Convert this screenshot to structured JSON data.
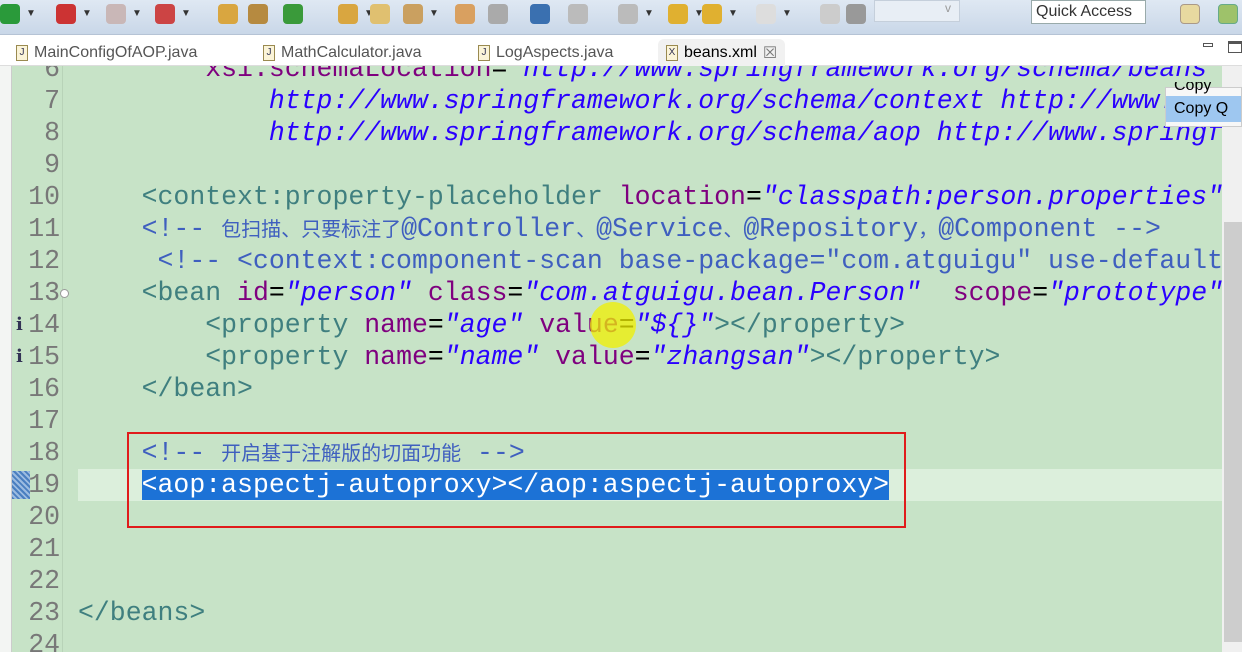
{
  "toolbar": {
    "quick_access": "Quick Access",
    "combo_arrow": "v",
    "icons": [
      "run-icon",
      "debug-icon",
      "stop-icon",
      "external-tools-icon",
      "new-icon",
      "package-icon",
      "refresh-icon",
      "open-folder-icon",
      "open-file-icon",
      "pen-icon",
      "bookmark-icon",
      "settings-icon",
      "globe-icon",
      "next-annotation-icon",
      "prev-annotation-icon",
      "back-icon",
      "back-history-icon",
      "forward-icon",
      "pin-icon",
      "grid-icon"
    ]
  },
  "tabs": [
    {
      "label": "MainConfigOfAOP.java",
      "icon": "J"
    },
    {
      "label": "MathCalculator.java",
      "icon": "J"
    },
    {
      "label": "LogAspects.java",
      "icon": "J"
    },
    {
      "label": "beans.xml",
      "icon": "X",
      "active": true,
      "close": "☒"
    }
  ],
  "popup": {
    "items": [
      "Copy",
      "Copy Q"
    ]
  },
  "colors": {
    "editor_bg": "#c7e3c7",
    "tag": "#3f7f7f",
    "attr": "#7f007f",
    "value": "#2a00ff",
    "comment": "#3f5fbf",
    "selection": "#1c72d6",
    "highlight_box": "#e01b1b"
  },
  "editor": {
    "lines": [
      {
        "n": "6",
        "indent": "        ",
        "parts": [
          [
            "a",
            "xsi:schemaLocation"
          ],
          [
            "k",
            "="
          ],
          [
            "v",
            "\"http://www.springframework.org/schema/beans http"
          ]
        ]
      },
      {
        "n": "7",
        "indent": "            ",
        "parts": [
          [
            "v",
            "http://www.springframework.org/schema/context http://www.spr"
          ]
        ]
      },
      {
        "n": "8",
        "indent": "            ",
        "parts": [
          [
            "v",
            "http://www.springframework.org/schema/aop http://www.springframe"
          ]
        ]
      },
      {
        "n": "9",
        "indent": "",
        "parts": []
      },
      {
        "n": "10",
        "indent": "    ",
        "parts": [
          [
            "t",
            "<context:property-placeholder "
          ],
          [
            "a",
            "location"
          ],
          [
            "k",
            "="
          ],
          [
            "v",
            "\"classpath:person.properties\""
          ]
        ]
      },
      {
        "n": "11",
        "indent": "    ",
        "parts": [
          [
            "c",
            "<!-- "
          ],
          [
            "ccn",
            "包扫描、只要标注了"
          ],
          [
            "c",
            "@Controller"
          ],
          [
            "ccn",
            "、"
          ],
          [
            "c",
            "@Service"
          ],
          [
            "ccn",
            "、"
          ],
          [
            "c",
            "@Repository"
          ],
          [
            "ccn",
            "，"
          ],
          [
            "c",
            "@Component -->"
          ]
        ]
      },
      {
        "n": "12",
        "indent": "     ",
        "parts": [
          [
            "c",
            "<!-- <context:component-scan base-package=\"com.atguigu\" use-default"
          ]
        ]
      },
      {
        "n": "13",
        "indent": "    ",
        "fold": true,
        "parts": [
          [
            "t",
            "<bean "
          ],
          [
            "a",
            "id"
          ],
          [
            "k",
            "="
          ],
          [
            "v",
            "\"person\""
          ],
          [
            "t",
            " "
          ],
          [
            "a",
            "class"
          ],
          [
            "k",
            "="
          ],
          [
            "v",
            "\"com.atguigu.bean.Person\""
          ],
          [
            "t",
            "  "
          ],
          [
            "a",
            "scope"
          ],
          [
            "k",
            "="
          ],
          [
            "v",
            "\"prototype\""
          ]
        ]
      },
      {
        "n": "14",
        "indent": "        ",
        "info": true,
        "parts": [
          [
            "t",
            "<property "
          ],
          [
            "a",
            "name"
          ],
          [
            "k",
            "="
          ],
          [
            "v",
            "\"age\""
          ],
          [
            "t",
            " "
          ],
          [
            "a",
            "value"
          ],
          [
            "k",
            "="
          ],
          [
            "v",
            "\"${}\""
          ],
          [
            "t",
            "></property>"
          ]
        ]
      },
      {
        "n": "15",
        "indent": "        ",
        "info": true,
        "parts": [
          [
            "t",
            "<property "
          ],
          [
            "a",
            "name"
          ],
          [
            "k",
            "="
          ],
          [
            "v",
            "\"name\""
          ],
          [
            "t",
            " "
          ],
          [
            "a",
            "value"
          ],
          [
            "k",
            "="
          ],
          [
            "v",
            "\"zhangsan\""
          ],
          [
            "t",
            "></property>"
          ]
        ]
      },
      {
        "n": "16",
        "indent": "    ",
        "parts": [
          [
            "t",
            "</bean>"
          ]
        ]
      },
      {
        "n": "17",
        "indent": "",
        "parts": []
      },
      {
        "n": "18",
        "indent": "    ",
        "parts": [
          [
            "c",
            "<!-- "
          ],
          [
            "ccn",
            "开启基于注解版的切面功能"
          ],
          [
            "c",
            " -->"
          ]
        ]
      },
      {
        "n": "19",
        "indent": "    ",
        "current": true,
        "parts": [
          [
            "sel",
            "<aop:aspectj-autoproxy></aop:aspectj-autoproxy>"
          ]
        ]
      },
      {
        "n": "20",
        "indent": "",
        "parts": []
      },
      {
        "n": "21",
        "indent": "",
        "parts": []
      },
      {
        "n": "22",
        "indent": "",
        "parts": []
      },
      {
        "n": "23",
        "indent": "",
        "parts": [
          [
            "t",
            "</beans>"
          ]
        ]
      },
      {
        "n": "24",
        "indent": "",
        "parts": []
      }
    ]
  }
}
